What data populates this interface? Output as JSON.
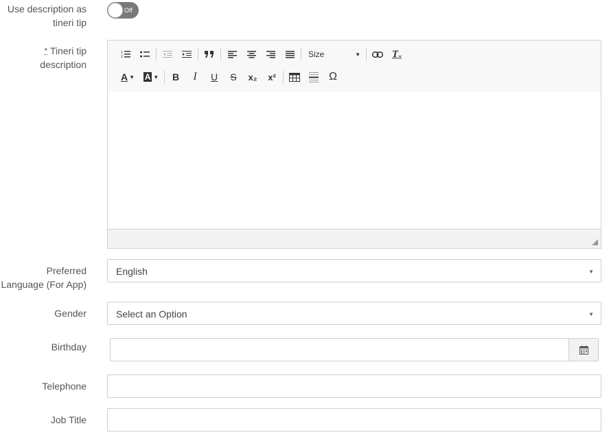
{
  "fields": {
    "use_description": {
      "label_line1": "Use description as",
      "label_line2": "tineri tip",
      "toggle_text": "Off"
    },
    "tip_description": {
      "required_mark": "*",
      "label_line1": "Tineri tip",
      "label_line2": "description"
    },
    "preferred_language": {
      "label_line1": "Preferred",
      "label_line2": "Language (For App)",
      "value": "English"
    },
    "gender": {
      "label": "Gender",
      "value": "Select an Option"
    },
    "birthday": {
      "label": "Birthday",
      "value": ""
    },
    "telephone": {
      "label": "Telephone",
      "value": ""
    },
    "job_title": {
      "label": "Job Title",
      "value": ""
    }
  },
  "editor": {
    "size_label": "Size",
    "toolbar_row1": [
      "numbered-list-icon",
      "bulleted-list-icon",
      "outdent-icon",
      "indent-icon",
      "blockquote-icon",
      "align-left-icon",
      "align-center-icon",
      "align-right-icon",
      "align-justify-icon",
      "link-icon",
      "clear-format-icon"
    ],
    "toolbar_row2": [
      "text-color-icon",
      "background-color-icon",
      "bold-icon",
      "italic-icon",
      "underline-icon",
      "strikethrough-icon",
      "subscript-icon",
      "superscript-icon",
      "table-icon",
      "horizontal-line-icon",
      "special-char-icon"
    ],
    "glyphs": {
      "bold": "B",
      "italic": "I",
      "underline": "U",
      "strike": "S",
      "subscript": "x₂",
      "superscript": "x²",
      "omega": "Ω",
      "text_color": "A",
      "bg_color": "A",
      "clear_format": "T"
    }
  }
}
